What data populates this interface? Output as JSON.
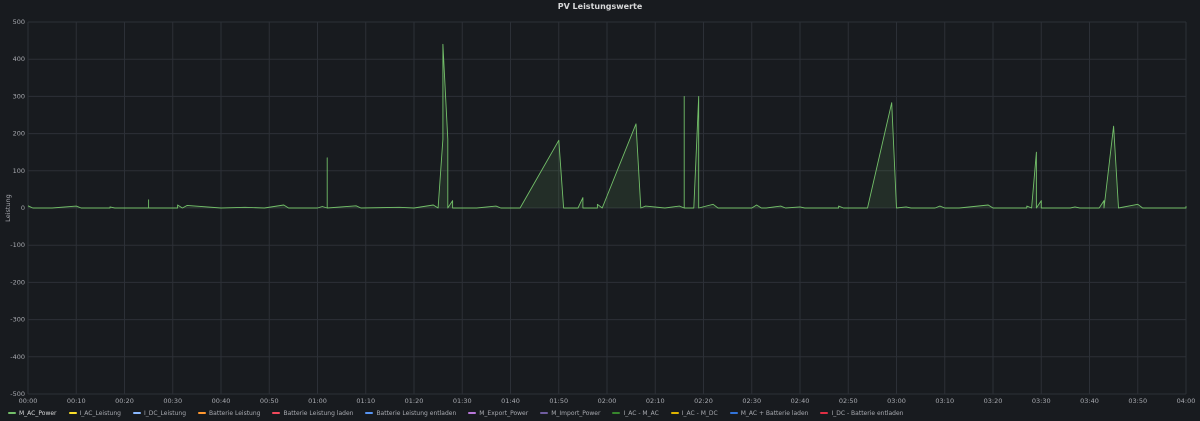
{
  "chart_data": {
    "type": "area",
    "title": "PV Leistungswerte",
    "ylabel": "Leistung",
    "xlabel": "",
    "ylim": [
      -500,
      500
    ],
    "y_ticks": [
      "500",
      "400",
      "300",
      "200",
      "100",
      "0",
      "-100",
      "-200",
      "-300",
      "-400",
      "-500"
    ],
    "x_ticks": [
      "00:00",
      "00:10",
      "00:20",
      "00:30",
      "00:40",
      "00:50",
      "01:00",
      "01:10",
      "01:20",
      "01:30",
      "01:40",
      "01:50",
      "02:00",
      "02:10",
      "02:20",
      "02:30",
      "02:40",
      "02:50",
      "03:00",
      "03:10",
      "03:20",
      "03:30",
      "03:40",
      "03:50",
      "04:00"
    ],
    "xlim_minutes": [
      0,
      240
    ],
    "grid": true,
    "legend_position": "bottom",
    "series": [
      {
        "name": "M_AC_Power",
        "color": "#73bf69",
        "points": [
          [
            "00:00",
            6
          ],
          [
            "00:01",
            0
          ],
          [
            "00:05",
            0
          ],
          [
            "00:10",
            5
          ],
          [
            "00:11",
            0
          ],
          [
            "00:17",
            0
          ],
          [
            "00:17",
            3
          ],
          [
            "00:18",
            0
          ],
          [
            "00:25",
            0
          ],
          [
            "00:25",
            22
          ],
          [
            "00:25",
            0
          ],
          [
            "00:31",
            0
          ],
          [
            "00:31",
            8
          ],
          [
            "00:32",
            0
          ],
          [
            "00:33",
            7
          ],
          [
            "00:40",
            0
          ],
          [
            "00:45",
            2
          ],
          [
            "00:49",
            0
          ],
          [
            "00:53",
            8
          ],
          [
            "00:54",
            0
          ],
          [
            "01:00",
            0
          ],
          [
            "01:01",
            4
          ],
          [
            "01:02",
            0
          ],
          [
            "01:02",
            135
          ],
          [
            "01:02",
            0
          ],
          [
            "01:08",
            6
          ],
          [
            "01:09",
            0
          ],
          [
            "01:17",
            2
          ],
          [
            "01:20",
            0
          ],
          [
            "01:24",
            8
          ],
          [
            "01:25",
            0
          ],
          [
            "01:26",
            185
          ],
          [
            "01:26",
            440
          ],
          [
            "01:27",
            185
          ],
          [
            "01:27",
            0
          ],
          [
            "01:28",
            20
          ],
          [
            "01:28",
            0
          ],
          [
            "01:33",
            0
          ],
          [
            "01:37",
            5
          ],
          [
            "01:38",
            0
          ],
          [
            "01:42",
            0
          ],
          [
            "01:50",
            182
          ],
          [
            "01:51",
            0
          ],
          [
            "01:54",
            0
          ],
          [
            "01:55",
            28
          ],
          [
            "01:55",
            0
          ],
          [
            "01:58",
            0
          ],
          [
            "01:58",
            10
          ],
          [
            "01:59",
            0
          ],
          [
            "02:06",
            226
          ],
          [
            "02:07",
            0
          ],
          [
            "02:08",
            5
          ],
          [
            "02:12",
            0
          ],
          [
            "02:15",
            5
          ],
          [
            "02:16",
            0
          ],
          [
            "02:16",
            300
          ],
          [
            "02:16",
            0
          ],
          [
            "02:18",
            0
          ],
          [
            "02:19",
            300
          ],
          [
            "02:19",
            0
          ],
          [
            "02:22",
            10
          ],
          [
            "02:23",
            0
          ],
          [
            "02:30",
            0
          ],
          [
            "02:31",
            8
          ],
          [
            "02:32",
            0
          ],
          [
            "02:33",
            0
          ],
          [
            "02:36",
            5
          ],
          [
            "02:37",
            0
          ],
          [
            "02:40",
            3
          ],
          [
            "02:41",
            0
          ],
          [
            "02:48",
            0
          ],
          [
            "02:48",
            5
          ],
          [
            "02:49",
            0
          ],
          [
            "02:54",
            0
          ],
          [
            "02:59",
            283
          ],
          [
            "03:00",
            0
          ],
          [
            "03:02",
            3
          ],
          [
            "03:03",
            0
          ],
          [
            "03:08",
            0
          ],
          [
            "03:09",
            5
          ],
          [
            "03:10",
            0
          ],
          [
            "03:13",
            0
          ],
          [
            "03:19",
            8
          ],
          [
            "03:20",
            0
          ],
          [
            "03:27",
            0
          ],
          [
            "03:27",
            5
          ],
          [
            "03:28",
            0
          ],
          [
            "03:29",
            150
          ],
          [
            "03:29",
            0
          ],
          [
            "03:30",
            20
          ],
          [
            "03:30",
            0
          ],
          [
            "03:36",
            0
          ],
          [
            "03:37",
            3
          ],
          [
            "03:38",
            0
          ],
          [
            "03:42",
            0
          ],
          [
            "03:43",
            20
          ],
          [
            "03:43",
            0
          ],
          [
            "03:45",
            220
          ],
          [
            "03:46",
            0
          ],
          [
            "03:50",
            10
          ],
          [
            "03:51",
            0
          ],
          [
            "04:00",
            0
          ],
          [
            "04:00",
            5
          ]
        ]
      },
      {
        "name": "I_AC_Leistung",
        "color": "#fade2a",
        "points": []
      },
      {
        "name": "I_DC_Leistung",
        "color": "#8ab8ff",
        "points": []
      },
      {
        "name": "Batterie Leistung",
        "color": "#ff9830",
        "points": []
      },
      {
        "name": "Batterie Leistung laden",
        "color": "#f2495c",
        "points": []
      },
      {
        "name": "Batterie Leistung entladen",
        "color": "#5794f2",
        "points": []
      },
      {
        "name": "M_Export_Power",
        "color": "#b877d9",
        "points": []
      },
      {
        "name": "M_Import_Power",
        "color": "#705da0",
        "points": []
      },
      {
        "name": "I_AC - M_AC",
        "color": "#37872d",
        "points": []
      },
      {
        "name": "I_AC - M_DC",
        "color": "#e0b400",
        "points": []
      },
      {
        "name": "M_AC + Batterie laden",
        "color": "#3274d9",
        "points": []
      },
      {
        "name": "I_DC - Batterie entladen",
        "color": "#e02f44",
        "points": []
      }
    ]
  }
}
